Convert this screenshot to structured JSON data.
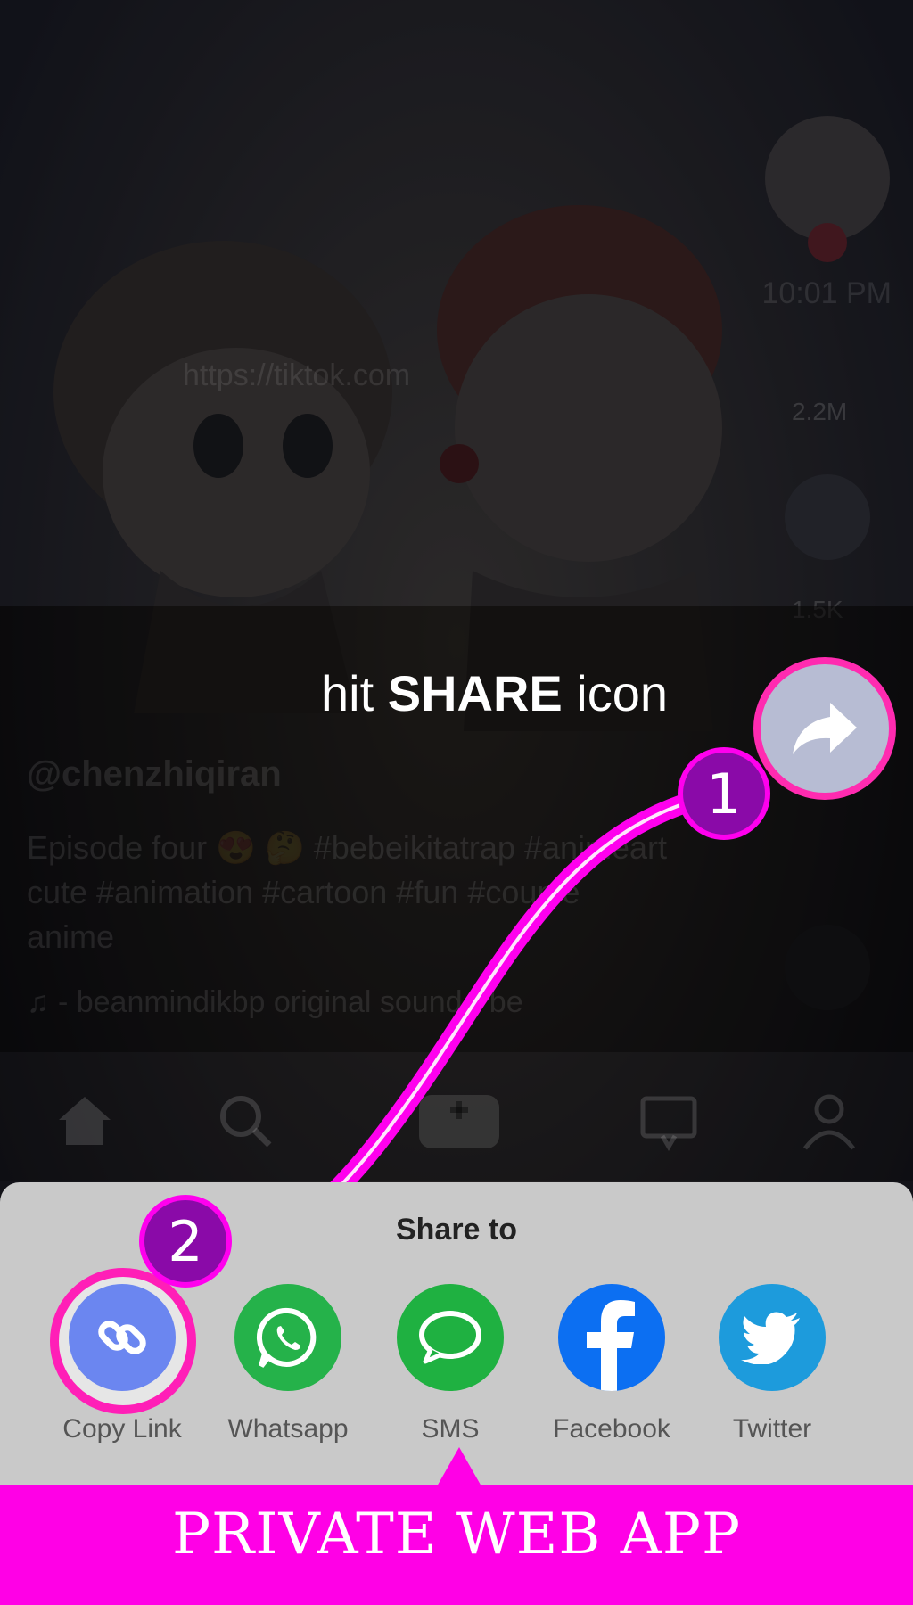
{
  "background": {
    "status_time": "10:01 PM",
    "url": "https://tiktok.com",
    "likes_count": "2.2M",
    "comments_count": "1.5K",
    "username": "@chenzhiqiran",
    "caption_line1": "Episode four 😍 🤔 #bebeikitatrap #animeart",
    "caption_line2": "cute #animation #cartoon #fun #couple",
    "caption_line3": "anime",
    "music": "♫  - beanmindikbp   original sound - be"
  },
  "instruction": {
    "prefix": "hit ",
    "bold": "SHARE",
    "suffix": " icon"
  },
  "steps": {
    "one": "1",
    "two": "2"
  },
  "share_sheet": {
    "title": "Share to",
    "options": [
      {
        "label": "Copy Link",
        "icon": "link-icon",
        "color": "#6b86f0"
      },
      {
        "label": "Whatsapp",
        "icon": "whatsapp-icon",
        "color": "#25b24a"
      },
      {
        "label": "SMS",
        "icon": "sms-icon",
        "color": "#1fb141"
      },
      {
        "label": "Facebook",
        "icon": "facebook-icon",
        "color": "#0c6ff2"
      },
      {
        "label": "Twitter",
        "icon": "twitter-icon",
        "color": "#1d9bdc"
      }
    ]
  },
  "banner": {
    "text": "PRIVATE WEB APP"
  },
  "colors": {
    "accent": "#ff00e6",
    "badge": "#8a0aa8",
    "highlight_ring": "#ff1fb7"
  }
}
